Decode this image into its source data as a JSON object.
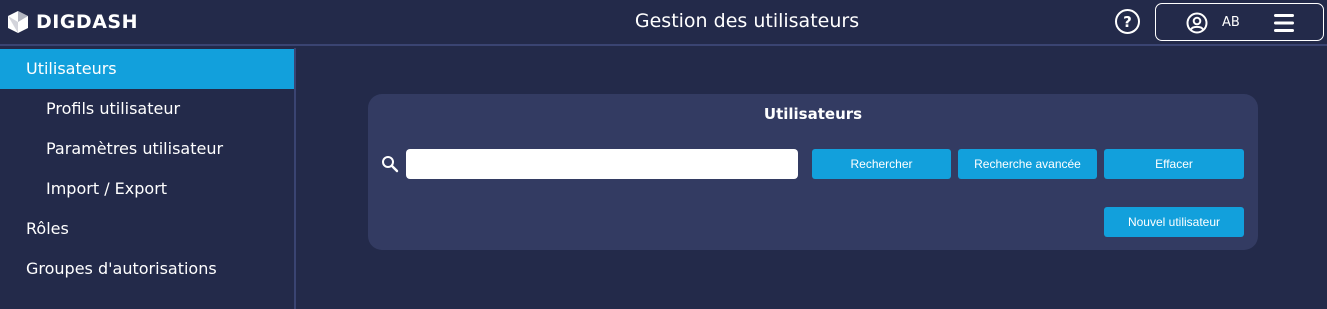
{
  "header": {
    "logo_text": "DIGDASH",
    "title": "Gestion des utilisateurs",
    "help_label": "?",
    "user_initials": "AB",
    "icons": [
      "logo-icon",
      "help-icon",
      "user-circle-icon",
      "hamburger-menu-icon"
    ]
  },
  "sidebar": {
    "items": [
      {
        "label": "Utilisateurs",
        "active": true
      },
      {
        "label": "Profils utilisateur"
      },
      {
        "label": "Paramètres utilisateur"
      },
      {
        "label": "Import / Export"
      },
      {
        "label": "Rôles"
      },
      {
        "label": "Groupes d'autorisations"
      }
    ]
  },
  "panel": {
    "title": "Utilisateurs",
    "search": {
      "value": "",
      "placeholder": ""
    },
    "buttons": {
      "search": "Rechercher",
      "advanced": "Recherche avancée",
      "clear": "Effacer",
      "new_user": "Nouvel utilisateur"
    }
  },
  "colors": {
    "background": "#232a4a",
    "panel": "#333b62",
    "accent": "#12a0dc"
  }
}
